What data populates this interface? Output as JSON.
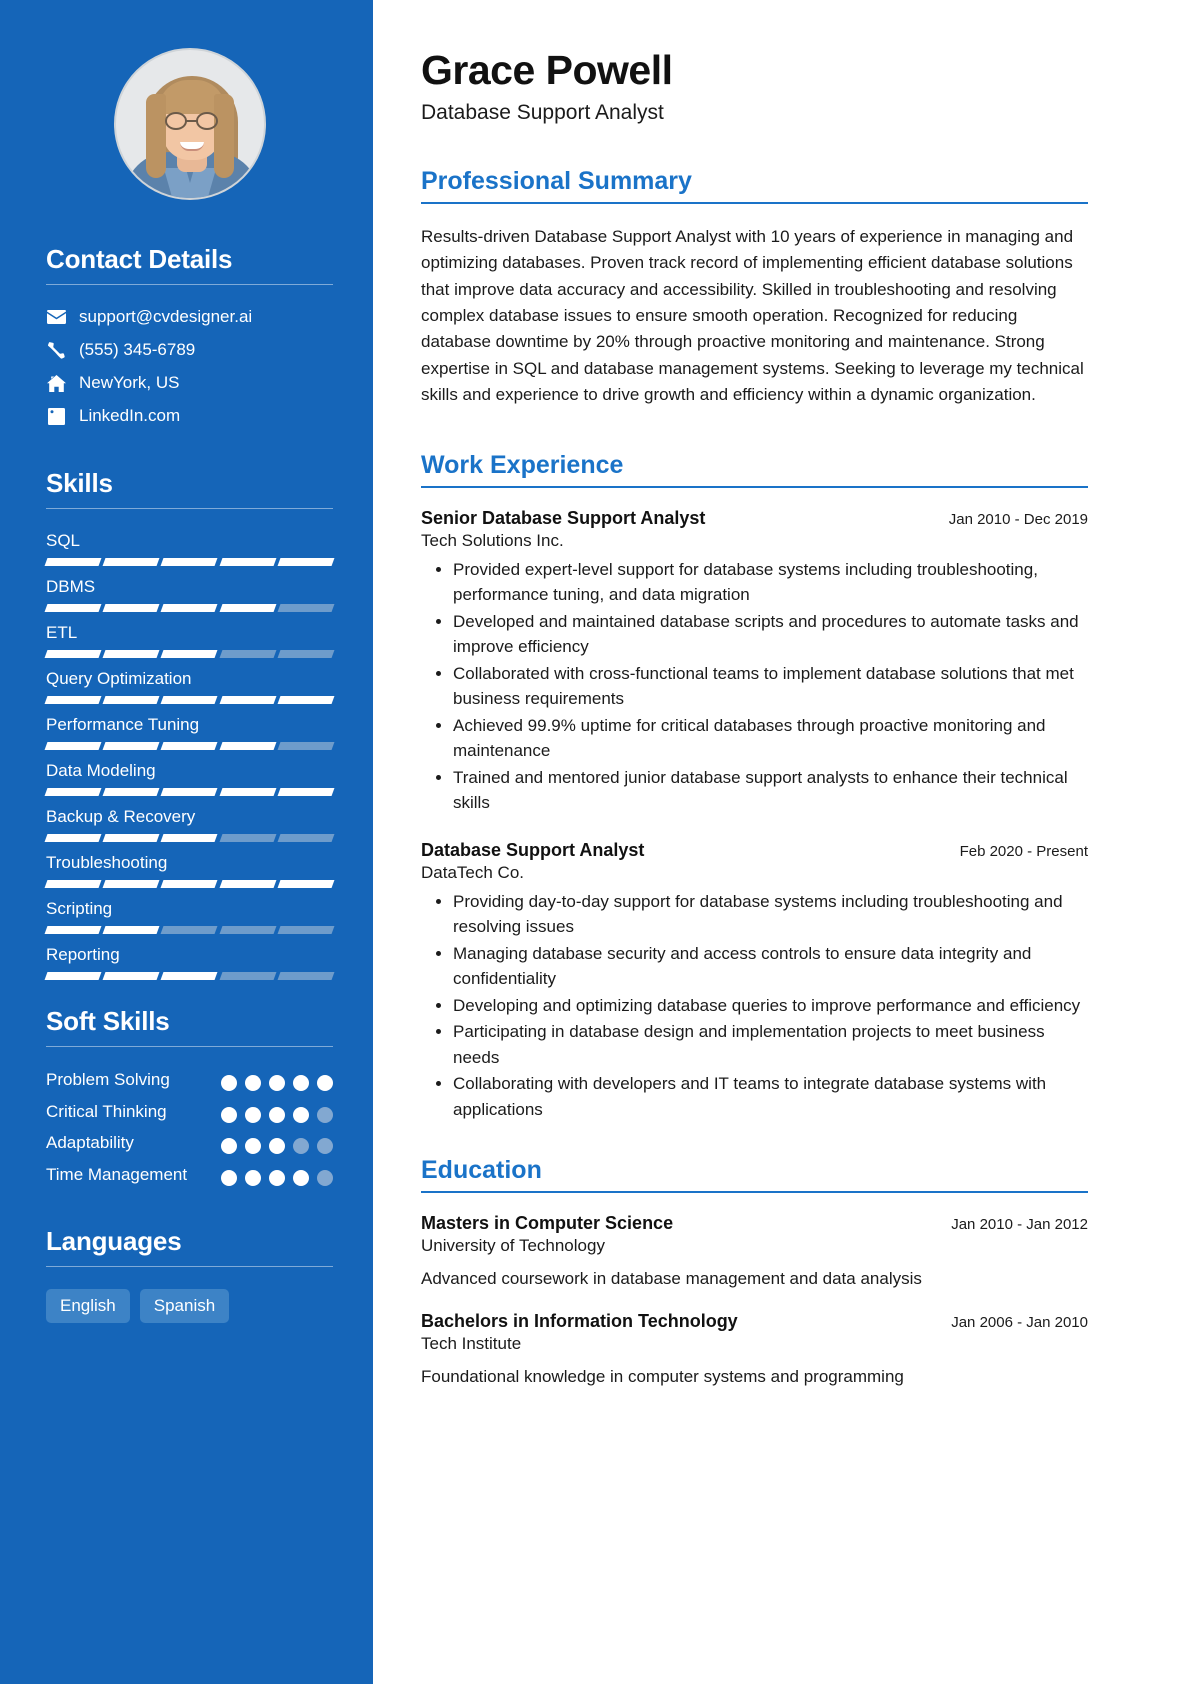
{
  "profile": {
    "name": "Grace Powell",
    "role": "Database Support Analyst",
    "avatar_alt": "profile-photo"
  },
  "sidebar": {
    "contact": {
      "heading": "Contact Details",
      "items": [
        {
          "icon": "envelope-icon",
          "value": "support@cvdesigner.ai"
        },
        {
          "icon": "phone-icon",
          "value": "(555) 345-6789"
        },
        {
          "icon": "home-icon",
          "value": "NewYork, US"
        },
        {
          "icon": "linkedin-icon",
          "value": "LinkedIn.com"
        }
      ]
    },
    "skills": {
      "heading": "Skills",
      "max": 5,
      "items": [
        {
          "label": "SQL",
          "level": 5
        },
        {
          "label": "DBMS",
          "level": 4
        },
        {
          "label": "ETL",
          "level": 3
        },
        {
          "label": "Query Optimization",
          "level": 5
        },
        {
          "label": "Performance Tuning",
          "level": 4
        },
        {
          "label": "Data Modeling",
          "level": 5
        },
        {
          "label": "Backup & Recovery",
          "level": 3
        },
        {
          "label": "Troubleshooting",
          "level": 5
        },
        {
          "label": "Scripting",
          "level": 2
        },
        {
          "label": "Reporting",
          "level": 3
        }
      ]
    },
    "soft_skills": {
      "heading": "Soft Skills",
      "max": 5,
      "items": [
        {
          "label": "Problem Solving",
          "level": 5
        },
        {
          "label": "Critical Thinking",
          "level": 4
        },
        {
          "label": "Adaptability",
          "level": 3
        },
        {
          "label": "Time Management",
          "level": 4
        }
      ]
    },
    "languages": {
      "heading": "Languages",
      "items": [
        "English",
        "Spanish"
      ]
    }
  },
  "main": {
    "summary": {
      "heading": "Professional Summary",
      "text": "Results-driven Database Support Analyst with 10 years of experience in managing and optimizing databases. Proven track record of implementing efficient database solutions that improve data accuracy and accessibility. Skilled in troubleshooting and resolving complex database issues to ensure smooth operation. Recognized for reducing database downtime by 20% through proactive monitoring and maintenance. Strong expertise in SQL and database management systems. Seeking to leverage my technical skills and experience to drive growth and efficiency within a dynamic organization."
    },
    "work": {
      "heading": "Work Experience",
      "entries": [
        {
          "title": "Senior Database Support Analyst",
          "org": "Tech Solutions Inc.",
          "date": "Jan 2010 - Dec 2019",
          "bullets": [
            "Provided expert-level support for database systems including troubleshooting, performance tuning, and data migration",
            "Developed and maintained database scripts and procedures to automate tasks and improve efficiency",
            "Collaborated with cross-functional teams to implement database solutions that met business requirements",
            "Achieved 99.9% uptime for critical databases through proactive monitoring and maintenance",
            "Trained and mentored junior database support analysts to enhance their technical skills"
          ]
        },
        {
          "title": "Database Support Analyst",
          "org": "DataTech Co.",
          "date": "Feb 2020 - Present",
          "bullets": [
            "Providing day-to-day support for database systems including troubleshooting and resolving issues",
            "Managing database security and access controls to ensure data integrity and confidentiality",
            "Developing and optimizing database queries to improve performance and efficiency",
            "Participating in database design and implementation projects to meet business needs",
            "Collaborating with developers and IT teams to integrate database systems with applications"
          ]
        }
      ]
    },
    "education": {
      "heading": "Education",
      "entries": [
        {
          "title": "Masters in Computer Science",
          "org": "University of Technology",
          "date": "Jan 2010 - Jan 2012",
          "desc": "Advanced coursework in database management and data analysis"
        },
        {
          "title": "Bachelors in Information Technology",
          "org": "Tech Institute",
          "date": "Jan 2006 - Jan 2010",
          "desc": "Foundational knowledge in computer systems and programming"
        }
      ]
    }
  },
  "theme": {
    "sidebar_bg": "#1565b8",
    "accent": "#1a73c8",
    "seg_off": "#6e9ccb",
    "dot_off": "#82a8d1",
    "pill_bg": "#3d83c6"
  }
}
